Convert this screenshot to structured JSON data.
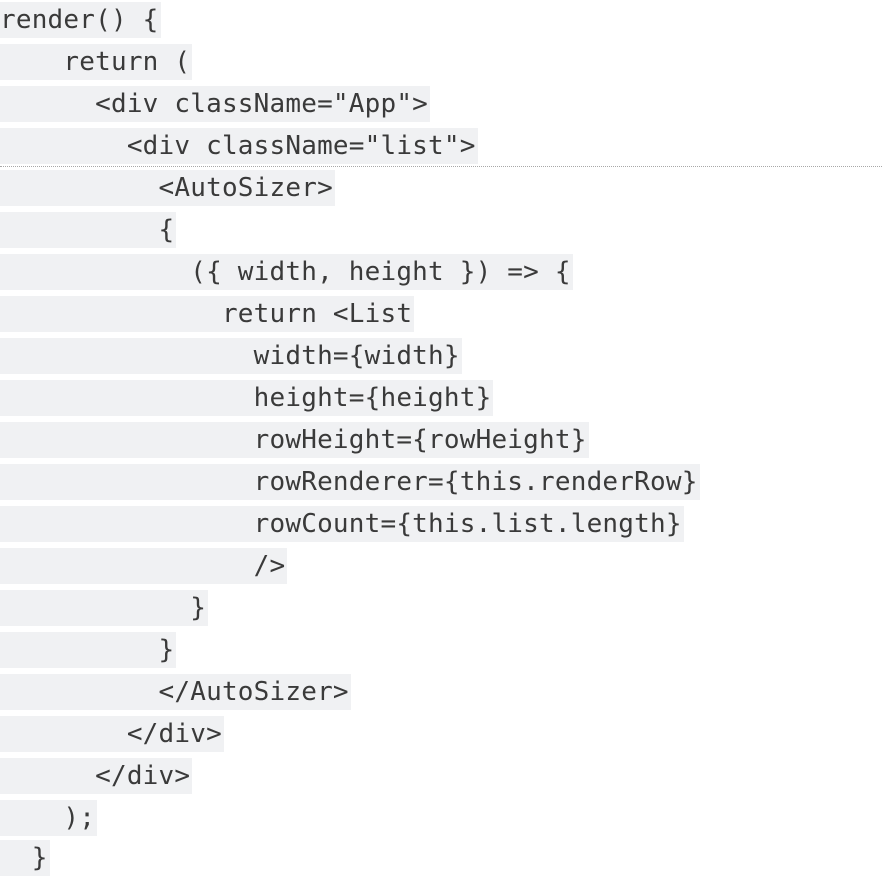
{
  "code": {
    "lines": [
      "render() {",
      "    return (",
      "      <div className=\"App\">",
      "        <div className=\"list\">",
      "          <AutoSizer>",
      "          {",
      "            ({ width, height }) => {",
      "              return <List",
      "                width={width}",
      "                height={height}",
      "                rowHeight={rowHeight}",
      "                rowRenderer={this.renderRow}",
      "                rowCount={this.list.length}",
      "                />",
      "            }",
      "          }",
      "          </AutoSizer>",
      "        </div>",
      "      </div>",
      "    );",
      "  }"
    ]
  }
}
